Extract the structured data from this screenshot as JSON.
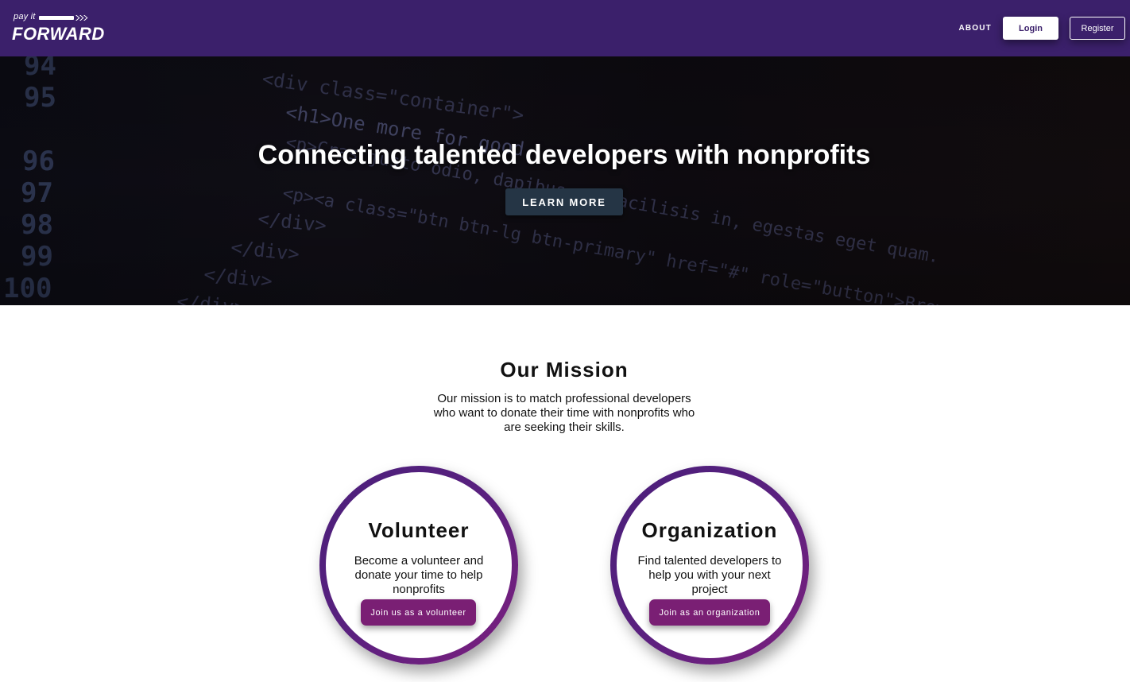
{
  "brand": {
    "logo_small": "pay it",
    "logo_big": "FORWARD"
  },
  "nav": {
    "about": "ABOUT",
    "login": "Login",
    "register": "Register"
  },
  "hero": {
    "title": "Connecting talented developers with nonprofits",
    "button": "LEARN MORE",
    "code_lines": [
      "<div class=\"container\">",
      "<h1>One more for good",
      "<p>Cras justo odio, dapibus ac facilisis in, egestas eget quam.",
      "<p><a class=\"btn btn-lg btn-primary\" href=\"#\" role=\"button\">Browse gallery",
      "</div>",
      "</div>",
      "</div>",
      "</div>"
    ],
    "line_numbers": [
      "94",
      "95",
      "96",
      "97",
      "98",
      "99",
      "100"
    ]
  },
  "mission": {
    "title": "Our Mission",
    "text": "Our mission is to match professional developers who want to donate their time with nonprofits who are seeking their skills."
  },
  "cards": {
    "volunteer": {
      "title": "Volunteer",
      "text": "Become a volunteer and donate your time to help nonprofits",
      "button": "Join us as a volunteer"
    },
    "organization": {
      "title": "Organization",
      "text": "Find talented developers to help you with your next project",
      "button": "Join as an organization"
    }
  },
  "colors": {
    "navbar": "#3b206b",
    "learn_button": "#253545",
    "card_button": "#7a1f74",
    "ring_start": "#4a1f7a",
    "ring_end": "#7d1f7e"
  }
}
